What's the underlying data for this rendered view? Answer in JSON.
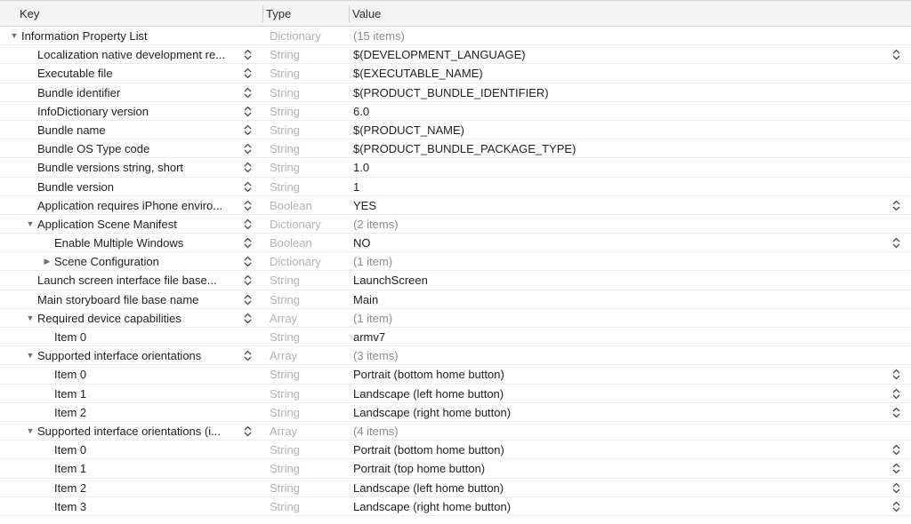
{
  "header": {
    "key": "Key",
    "type": "Type",
    "value": "Value"
  },
  "rows": [
    {
      "key": "Information Property List",
      "type": "Dictionary",
      "value": "(15 items)",
      "level": 0,
      "tri": "down",
      "keyStepper": false,
      "valStepper": false,
      "muted": true
    },
    {
      "key": "Localization native development re...",
      "type": "String",
      "value": "$(DEVELOPMENT_LANGUAGE)",
      "level": 1,
      "tri": "",
      "keyStepper": true,
      "valStepper": true,
      "muted": false
    },
    {
      "key": "Executable file",
      "type": "String",
      "value": "$(EXECUTABLE_NAME)",
      "level": 1,
      "tri": "",
      "keyStepper": true,
      "valStepper": false,
      "muted": false
    },
    {
      "key": "Bundle identifier",
      "type": "String",
      "value": "$(PRODUCT_BUNDLE_IDENTIFIER)",
      "level": 1,
      "tri": "",
      "keyStepper": true,
      "valStepper": false,
      "muted": false
    },
    {
      "key": "InfoDictionary version",
      "type": "String",
      "value": "6.0",
      "level": 1,
      "tri": "",
      "keyStepper": true,
      "valStepper": false,
      "muted": false
    },
    {
      "key": "Bundle name",
      "type": "String",
      "value": "$(PRODUCT_NAME)",
      "level": 1,
      "tri": "",
      "keyStepper": true,
      "valStepper": false,
      "muted": false
    },
    {
      "key": "Bundle OS Type code",
      "type": "String",
      "value": "$(PRODUCT_BUNDLE_PACKAGE_TYPE)",
      "level": 1,
      "tri": "",
      "keyStepper": true,
      "valStepper": false,
      "muted": false
    },
    {
      "key": "Bundle versions string, short",
      "type": "String",
      "value": "1.0",
      "level": 1,
      "tri": "",
      "keyStepper": true,
      "valStepper": false,
      "muted": false
    },
    {
      "key": "Bundle version",
      "type": "String",
      "value": "1",
      "level": 1,
      "tri": "",
      "keyStepper": true,
      "valStepper": false,
      "muted": false
    },
    {
      "key": "Application requires iPhone enviro...",
      "type": "Boolean",
      "value": "YES",
      "level": 1,
      "tri": "",
      "keyStepper": true,
      "valStepper": true,
      "muted": false
    },
    {
      "key": "Application Scene Manifest",
      "type": "Dictionary",
      "value": "(2 items)",
      "level": 1,
      "tri": "down",
      "keyStepper": true,
      "valStepper": false,
      "muted": true
    },
    {
      "key": "Enable Multiple Windows",
      "type": "Boolean",
      "value": "NO",
      "level": 2,
      "tri": "",
      "keyStepper": true,
      "valStepper": true,
      "muted": false
    },
    {
      "key": "Scene Configuration",
      "type": "Dictionary",
      "value": "(1 item)",
      "level": 2,
      "tri": "right",
      "keyStepper": true,
      "valStepper": false,
      "muted": true
    },
    {
      "key": "Launch screen interface file base...",
      "type": "String",
      "value": "LaunchScreen",
      "level": 1,
      "tri": "",
      "keyStepper": true,
      "valStepper": false,
      "muted": false
    },
    {
      "key": "Main storyboard file base name",
      "type": "String",
      "value": "Main",
      "level": 1,
      "tri": "",
      "keyStepper": true,
      "valStepper": false,
      "muted": false
    },
    {
      "key": "Required device capabilities",
      "type": "Array",
      "value": "(1 item)",
      "level": 1,
      "tri": "down",
      "keyStepper": true,
      "valStepper": false,
      "muted": true
    },
    {
      "key": "Item 0",
      "type": "String",
      "value": "armv7",
      "level": 2,
      "tri": "",
      "keyStepper": false,
      "valStepper": false,
      "muted": false
    },
    {
      "key": "Supported interface orientations",
      "type": "Array",
      "value": "(3 items)",
      "level": 1,
      "tri": "down",
      "keyStepper": true,
      "valStepper": false,
      "muted": true
    },
    {
      "key": "Item 0",
      "type": "String",
      "value": "Portrait (bottom home button)",
      "level": 2,
      "tri": "",
      "keyStepper": false,
      "valStepper": true,
      "muted": false
    },
    {
      "key": "Item 1",
      "type": "String",
      "value": "Landscape (left home button)",
      "level": 2,
      "tri": "",
      "keyStepper": false,
      "valStepper": true,
      "muted": false
    },
    {
      "key": "Item 2",
      "type": "String",
      "value": "Landscape (right home button)",
      "level": 2,
      "tri": "",
      "keyStepper": false,
      "valStepper": true,
      "muted": false
    },
    {
      "key": "Supported interface orientations (i...",
      "type": "Array",
      "value": "(4 items)",
      "level": 1,
      "tri": "down",
      "keyStepper": true,
      "valStepper": false,
      "muted": true
    },
    {
      "key": "Item 0",
      "type": "String",
      "value": "Portrait (bottom home button)",
      "level": 2,
      "tri": "",
      "keyStepper": false,
      "valStepper": true,
      "muted": false
    },
    {
      "key": "Item 1",
      "type": "String",
      "value": "Portrait (top home button)",
      "level": 2,
      "tri": "",
      "keyStepper": false,
      "valStepper": true,
      "muted": false
    },
    {
      "key": "Item 2",
      "type": "String",
      "value": "Landscape (left home button)",
      "level": 2,
      "tri": "",
      "keyStepper": false,
      "valStepper": true,
      "muted": false
    },
    {
      "key": "Item 3",
      "type": "String",
      "value": "Landscape (right home button)",
      "level": 2,
      "tri": "",
      "keyStepper": false,
      "valStepper": true,
      "muted": false
    }
  ]
}
